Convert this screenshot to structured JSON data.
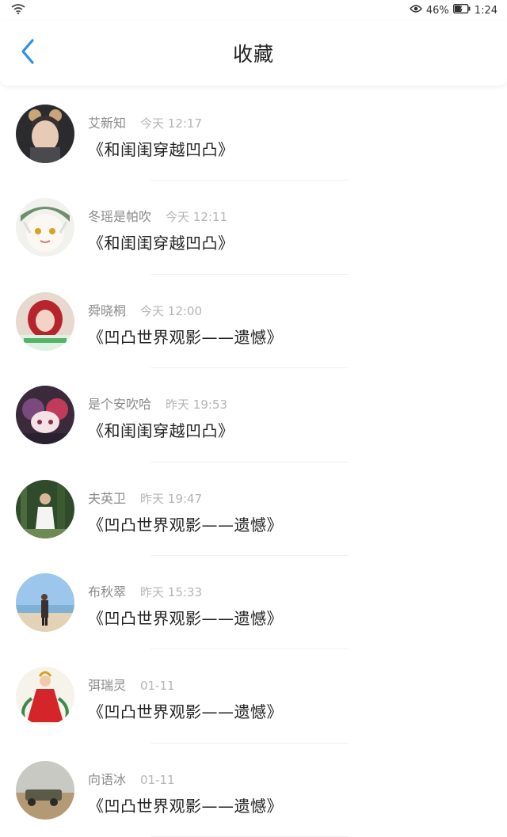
{
  "status": {
    "battery": "46%",
    "time": "1:24",
    "icons": [
      "wifi-icon",
      "eye-icon",
      "battery-icon"
    ]
  },
  "header": {
    "title": "收藏",
    "back_icon": "chevron-left-icon",
    "accent": "#2f8fe8"
  },
  "items": [
    {
      "name": "艾新知",
      "time": "今天 12:17",
      "title": "《和闺闺穿越凹凸》",
      "avatar": "dark-photo"
    },
    {
      "name": "冬瑶是帕吹",
      "time": "今天 12:11",
      "title": "《和闺闺穿越凹凸》",
      "avatar": "anime-white"
    },
    {
      "name": "舜晓桐",
      "time": "今天 12:00",
      "title": "《凹凸世界观影——遗憾》",
      "avatar": "red-hair"
    },
    {
      "name": "是个安吹哈",
      "time": "昨天 19:53",
      "title": "《和闺闺穿越凹凸》",
      "avatar": "anime-dark"
    },
    {
      "name": "夫英卫",
      "time": "昨天 19:47",
      "title": "《凹凸世界观影——遗憾》",
      "avatar": "forest"
    },
    {
      "name": "布秋翠",
      "time": "昨天 15:33",
      "title": "《凹凸世界观影——遗憾》",
      "avatar": "beach"
    },
    {
      "name": "弭瑞灵",
      "time": "01-11",
      "title": "《凹凸世界观影——遗憾》",
      "avatar": "red-dress"
    },
    {
      "name": "向语冰",
      "time": "01-11",
      "title": "《凹凸世界观影——遗憾》",
      "avatar": "desert"
    }
  ]
}
